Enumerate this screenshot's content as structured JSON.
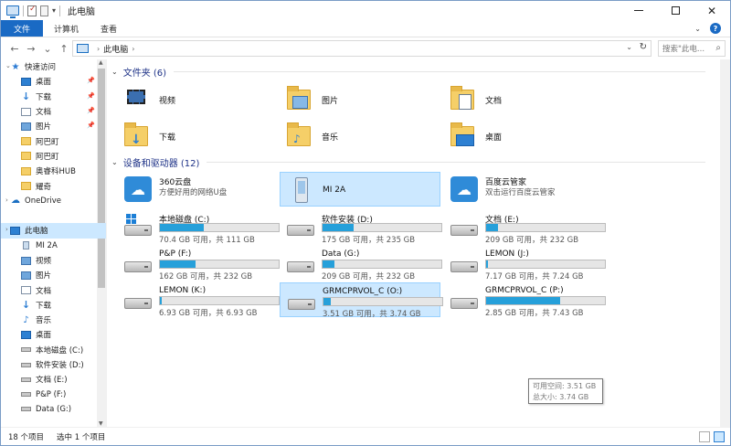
{
  "window": {
    "title": "此电脑",
    "controls": {
      "minimize": "—",
      "maximize": "□",
      "close": "✕"
    }
  },
  "ribbon": {
    "tabs": [
      "文件",
      "计算机",
      "查看"
    ]
  },
  "nav": {
    "back": "←",
    "forward": "→",
    "recent": "⌄",
    "up": "↑",
    "breadcrumb": [
      "此电脑"
    ],
    "search_placeholder": "搜索\"此电..."
  },
  "sidebar": {
    "items": [
      {
        "label": "快速访问",
        "icon": "star-icon",
        "pinned": false
      },
      {
        "label": "桌面",
        "icon": "desktop-icon",
        "pinned": true
      },
      {
        "label": "下载",
        "icon": "download-icon",
        "pinned": true
      },
      {
        "label": "文档",
        "icon": "document-icon",
        "pinned": true
      },
      {
        "label": "图片",
        "icon": "pictures-icon",
        "pinned": true
      },
      {
        "label": "阿巴町",
        "icon": "folder-icon",
        "pinned": false
      },
      {
        "label": "阿巴町",
        "icon": "folder-icon",
        "pinned": false
      },
      {
        "label": "奥睿科HUB",
        "icon": "folder-icon",
        "pinned": false
      },
      {
        "label": "耀奇",
        "icon": "folder-icon",
        "pinned": false
      },
      {
        "label": "",
        "icon": "",
        "pinned": false
      },
      {
        "label": "OneDrive",
        "icon": "cloud-icon",
        "pinned": false
      },
      {
        "label": "",
        "icon": "",
        "pinned": false
      },
      {
        "label": "此电脑",
        "icon": "pc-icon",
        "pinned": false,
        "selected": true
      },
      {
        "label": "MI 2A",
        "icon": "phone-icon",
        "pinned": false
      },
      {
        "label": "视频",
        "icon": "video-icon",
        "pinned": false
      },
      {
        "label": "图片",
        "icon": "pictures-icon",
        "pinned": false
      },
      {
        "label": "文档",
        "icon": "document-icon",
        "pinned": false
      },
      {
        "label": "下载",
        "icon": "download-icon",
        "pinned": false
      },
      {
        "label": "音乐",
        "icon": "music-icon",
        "pinned": false
      },
      {
        "label": "桌面",
        "icon": "desktop-icon",
        "pinned": false
      },
      {
        "label": "本地磁盘 (C:)",
        "icon": "drive-icon",
        "pinned": false
      },
      {
        "label": "软件安装 (D:)",
        "icon": "drive-icon",
        "pinned": false
      },
      {
        "label": "文档 (E:)",
        "icon": "drive-icon",
        "pinned": false
      },
      {
        "label": "P&P (F:)",
        "icon": "drive-icon",
        "pinned": false
      },
      {
        "label": "Data (G:)",
        "icon": "drive-icon",
        "pinned": false
      }
    ]
  },
  "folders": {
    "header": "文件夹 (6)",
    "items": [
      {
        "label": "视频",
        "icon": "video-folder-icon"
      },
      {
        "label": "图片",
        "icon": "pictures-folder-icon"
      },
      {
        "label": "文档",
        "icon": "documents-folder-icon"
      },
      {
        "label": "下载",
        "icon": "downloads-folder-icon"
      },
      {
        "label": "音乐",
        "icon": "music-folder-icon"
      },
      {
        "label": "桌面",
        "icon": "desktop-folder-icon"
      }
    ]
  },
  "devices": {
    "header": "设备和驱动器 (12)",
    "apps": [
      {
        "label": "360云盘",
        "sub": "方便好用的网络U盘",
        "icon": "cloud360-icon"
      },
      {
        "label": "MI 2A",
        "sub": "",
        "icon": "phone-icon",
        "selected": true
      },
      {
        "label": "百度云管家",
        "sub": "双击运行百度云管家",
        "icon": "baidu-cloud-icon"
      }
    ],
    "drives": [
      {
        "label": "本地磁盘 (C:)",
        "free": "70.4 GB 可用，共 111 GB",
        "used": 0.37,
        "icon": "windows-drive-icon"
      },
      {
        "label": "软件安装 (D:)",
        "free": "175 GB 可用，共 235 GB",
        "used": 0.26,
        "icon": "drive-icon"
      },
      {
        "label": "文档 (E:)",
        "free": "209 GB 可用，共 232 GB",
        "used": 0.1,
        "icon": "drive-icon"
      },
      {
        "label": "P&P (F:)",
        "free": "162 GB 可用，共 232 GB",
        "used": 0.3,
        "icon": "drive-icon"
      },
      {
        "label": "Data (G:)",
        "free": "209 GB 可用，共 232 GB",
        "used": 0.1,
        "icon": "drive-icon"
      },
      {
        "label": "LEMON (J:)",
        "free": "7.17 GB 可用，共 7.24 GB",
        "used": 0.01,
        "icon": "drive-icon"
      },
      {
        "label": "LEMON (K:)",
        "free": "6.93 GB 可用，共 6.93 GB",
        "used": 0.0,
        "icon": "drive-icon"
      },
      {
        "label": "GRMCPRVOL_C (O:)",
        "free": "3.51 GB 可用，共 3.74 GB",
        "used": 0.06,
        "icon": "drive-icon",
        "selected": true
      },
      {
        "label": "GRMCPRVOL_C (P:)",
        "free": "2.85 GB 可用，共 7.43 GB",
        "used": 0.62,
        "icon": "drive-icon"
      }
    ],
    "tooltip": {
      "line1": "可用空间: 3.51 GB",
      "line2": "总大小: 3.74 GB"
    }
  },
  "status": {
    "count": "18 个项目",
    "selected": "选中 1 个项目"
  },
  "colors": {
    "accent": "#1a6ac4",
    "selection": "#cce8ff",
    "bar_fill": "#26a0da"
  }
}
